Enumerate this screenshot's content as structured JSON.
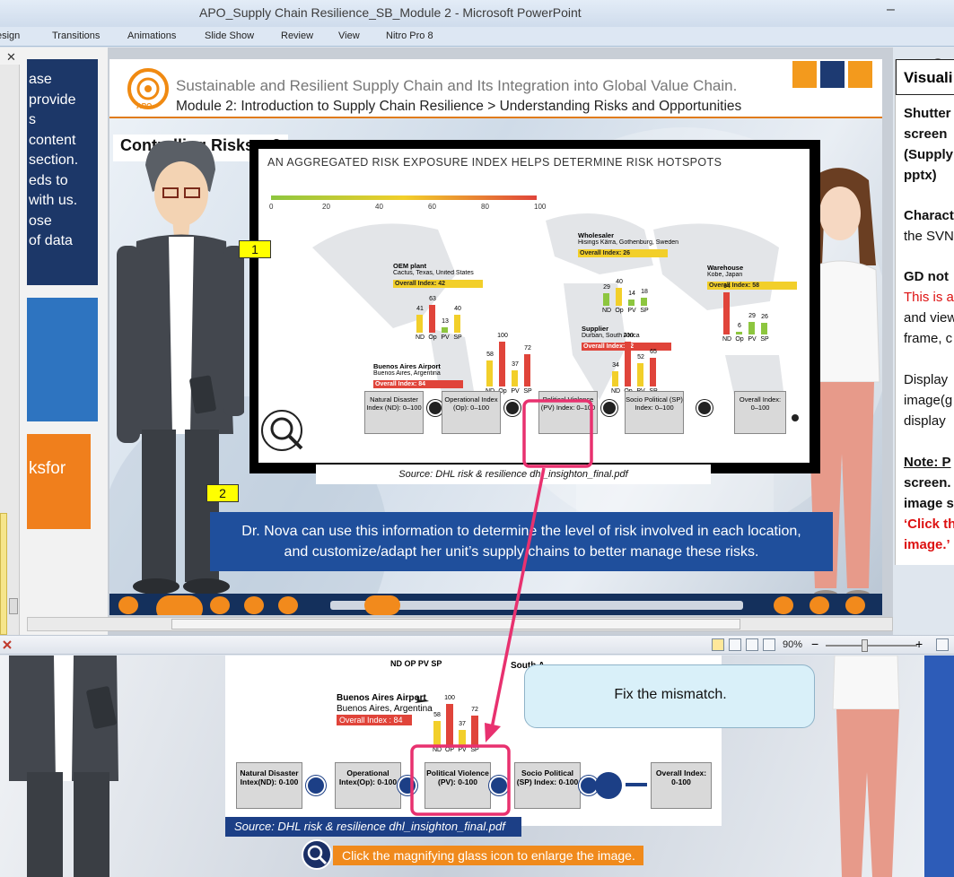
{
  "window": {
    "title": "APO_Supply Chain Resilience_SB_Module 2  -  Microsoft PowerPoint",
    "minimize_glyph": "–"
  },
  "ribbon": {
    "tabs": [
      "esign",
      "Transitions",
      "Animations",
      "Slide Show",
      "Review",
      "View",
      "Nitro Pro 8"
    ]
  },
  "thumbnails": {
    "slide_a_lines": [
      "ase",
      "provide",
      "s",
      "content",
      "section.",
      "eds to",
      "with us.",
      "ose",
      "of data"
    ],
    "slide_c_text": "ksfor"
  },
  "slide": {
    "logo_text": "APO",
    "header_title": "Sustainable and Resilient Supply Chain and Its Integration into Global Value Chain.",
    "header_module": "Module 2: Introduction to Supply Chain Resilience > Understanding Risks and Opportunities",
    "section_label": "Controlling Risks – 2",
    "infographic_heading": "AN AGGREGATED RISK EXPOSURE INDEX HELPS DETERMINE RISK HOTSPOTS",
    "scale_ticks": [
      "0",
      "20",
      "40",
      "60",
      "80",
      "100"
    ],
    "locations": [
      {
        "name": "OEM plant",
        "place": "Cactus, Texas, United States",
        "index": "Overall Index: 42",
        "values": [
          "41",
          "63",
          "13",
          "40"
        ]
      },
      {
        "name": "Wholesaler",
        "place": "Hisings Kärra, Gothenburg, Sweden",
        "index": "Overall Index: 26",
        "values": [
          "29",
          "40",
          "14",
          "18"
        ]
      },
      {
        "name": "Warehouse",
        "place": "Kobe, Japan",
        "index": "Overall Index: 58",
        "values": [
          "94",
          "6",
          "29",
          "26"
        ]
      },
      {
        "name": "Supplier",
        "place": "Durban, South Africa",
        "index": "Overall Index: 82",
        "values": [
          "34",
          "100",
          "52",
          "65"
        ]
      },
      {
        "name": "Buenos Aires Airport",
        "place": "Buenos Aires, Argentina",
        "index": "Overall Index: 84",
        "values": [
          "58",
          "100",
          "37",
          "72"
        ]
      }
    ],
    "bar_labels": [
      "ND",
      "Op",
      "PV",
      "SP"
    ],
    "flow_boxes": [
      "Natural Disaster Index (ND): 0–100",
      "Operational Index (Op): 0–100",
      "Political Violence (PV) Index: 0–100",
      "Socio Political (SP) Index: 0–100",
      "Overall Index: 0–100"
    ],
    "source": "Source: DHL risk & resilience dhl_insighton_final.pdf",
    "badge_1": "1",
    "badge_2": "2",
    "caption_line1": "Dr. Nova can use this information to determine the level of risk involved in each location,",
    "caption_line2": "and customize/adapt her unit’s supply chains to better manage these risks."
  },
  "notes": {
    "heading": "Visuali",
    "lines": [
      {
        "text": "Shutter",
        "bold": true
      },
      {
        "text": "screen",
        "bold": true
      },
      {
        "text": "(Supply",
        "bold": true
      },
      {
        "text": "pptx)",
        "bold": true
      },
      {
        "text": "Charact",
        "bold": true
      },
      {
        "text": "the SVN",
        "bold": false
      },
      {
        "text": "GD not",
        "bold": true
      },
      {
        "text": "This is a",
        "bold": false,
        "red": true
      },
      {
        "text": "and view",
        "bold": false
      },
      {
        "text": "frame, c",
        "bold": false
      },
      {
        "text": "Display",
        "bold": false
      },
      {
        "text": "image(g",
        "bold": false
      },
      {
        "text": "display",
        "bold": false
      },
      {
        "text": "Note: P",
        "bold": true,
        "underline": true
      },
      {
        "text": "screen.",
        "bold": true
      },
      {
        "text": "image s",
        "bold": true
      },
      {
        "text": "‘Click th",
        "bold": true,
        "red": true
      },
      {
        "text": "image.’",
        "bold": true,
        "red": true
      }
    ]
  },
  "statusbar": {
    "zoom": "90%",
    "minus": "−",
    "plus": "+"
  },
  "lower": {
    "top_labels": "ND  OP  PV  SP",
    "south_label": "South A",
    "airport_name": "Buenos Aires Airport",
    "airport_place": "Buenos Aires, Argentina",
    "airport_index": "Overall Index : 84",
    "airport_values": [
      "58",
      "100",
      "37",
      "72"
    ],
    "bar_labels": [
      "ND",
      "OP",
      "PV",
      "SP"
    ],
    "flow_boxes": [
      "Natural Disaster Intex(ND): 0-100",
      "Operational Intex(Op): 0-100",
      "Political Violence (PV): 0-100",
      "Socio Political (SP) Index: 0-100",
      "Overall Index: 0-100"
    ],
    "source": "Source: DHL risk & resilience dhl_insighton_final.pdf",
    "magnify_text": "Click the magnifying glass icon to enlarge the image."
  },
  "callout": {
    "text": "Fix the mismatch."
  },
  "colors": {
    "accent_orange": "#f08a1c",
    "navy": "#1c3768",
    "highlight_pink": "#e8316f",
    "bar_red": "#e0443a",
    "bar_yellow": "#f2cf2a",
    "bar_green": "#8dc63f"
  }
}
